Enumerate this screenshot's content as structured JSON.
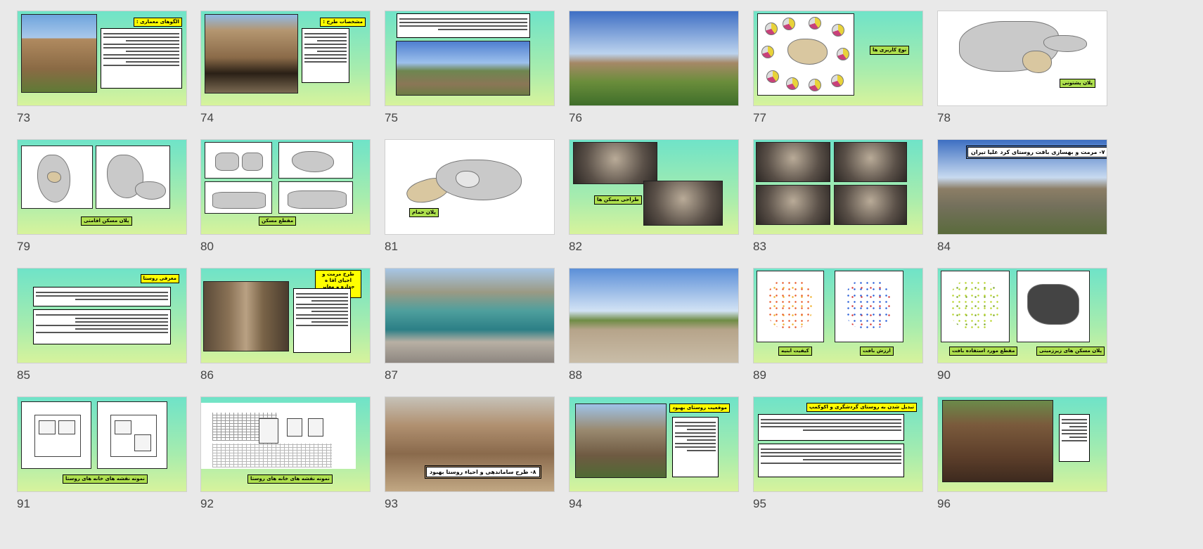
{
  "slides": [
    {
      "num": "73",
      "title": "الگوهای معماری :"
    },
    {
      "num": "74",
      "title": "مشخصات طرح :"
    },
    {
      "num": "75",
      "title": ""
    },
    {
      "num": "76",
      "title": ""
    },
    {
      "num": "77",
      "title": "نوع کاربری ها"
    },
    {
      "num": "78",
      "title": "پلان پشتونی"
    },
    {
      "num": "79",
      "title": "پلان مسکن اقامتی"
    },
    {
      "num": "80",
      "title": "مقطع مسکن"
    },
    {
      "num": "81",
      "title": "پلان حمام"
    },
    {
      "num": "82",
      "title": "طراحی مسکن ها"
    },
    {
      "num": "83",
      "title": ""
    },
    {
      "num": "84",
      "title": "۷- مرمت و بهسازی بافت روستای کرد علیا تیران"
    },
    {
      "num": "85",
      "title": "معرفی روستا"
    },
    {
      "num": "86",
      "title": "طرح مرمت و احیای اقا ه جداره و معابر روستا"
    },
    {
      "num": "87",
      "title": ""
    },
    {
      "num": "88",
      "title": ""
    },
    {
      "num": "89",
      "title": "کیفیت ابنیه",
      "title2": "ارزش بافت"
    },
    {
      "num": "90",
      "title": "مقطع مورد استفاده بافت",
      "title2": "پلان مسکن های زیرزمینی"
    },
    {
      "num": "91",
      "title": "نمونه نقشه های خانه های روستا"
    },
    {
      "num": "92",
      "title": "نمونه نقشه های خانه های روستا"
    },
    {
      "num": "93",
      "title": "۸- طرح ساماندهی و احیاء روستا بهبود"
    },
    {
      "num": "94",
      "title": "موقعیت روستای بهبود"
    },
    {
      "num": "95",
      "title": "تبدیل شدن به روستای گردشگری و اکوکمپ"
    },
    {
      "num": "96",
      "title": ""
    }
  ]
}
